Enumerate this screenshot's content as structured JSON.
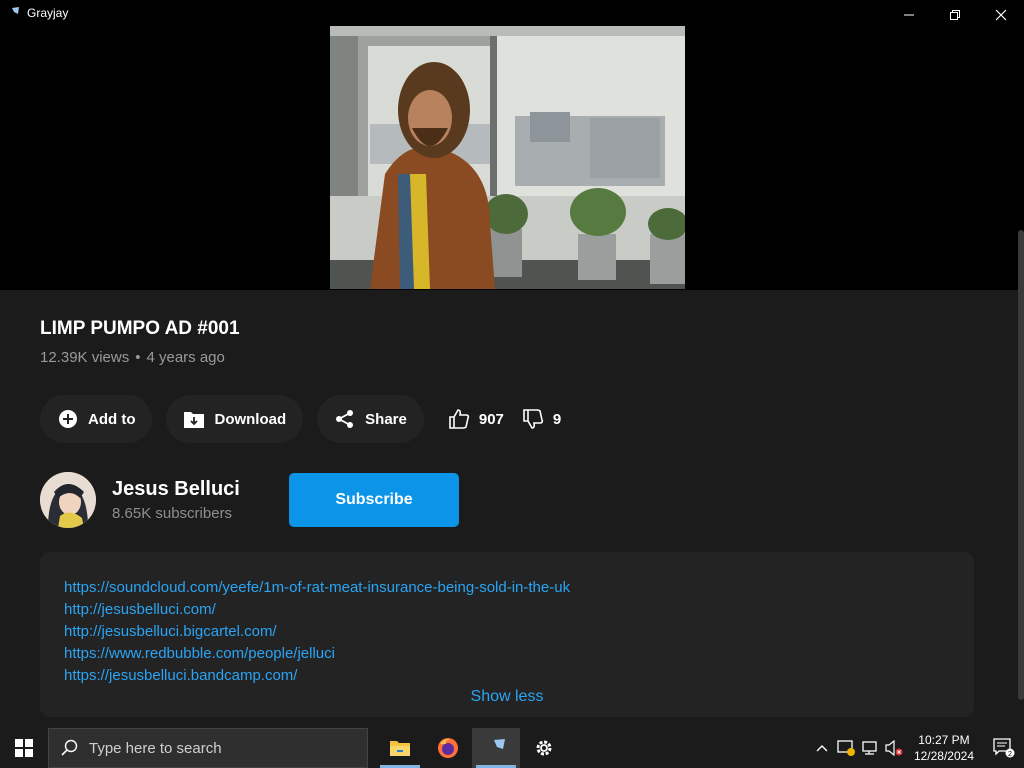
{
  "window": {
    "title": "Grayjay"
  },
  "video": {
    "title": "LIMP PUMPO AD #001",
    "views": "12.39K views",
    "separator": "•",
    "age": "4 years ago"
  },
  "actions": {
    "add_to": "Add to",
    "download": "Download",
    "share": "Share",
    "likes": "907",
    "dislikes": "9"
  },
  "channel": {
    "name": "Jesus Belluci",
    "subscribers": "8.65K subscribers",
    "subscribe_label": "Subscribe"
  },
  "description": {
    "links": [
      "https://soundcloud.com/yeefe/1m-of-rat-meat-insurance-being-sold-in-the-uk",
      "http://jesusbelluci.com/",
      "http://jesusbelluci.bigcartel.com/",
      "https://www.redbubble.com/people/jelluci",
      "https://jesusbelluci.bandcamp.com/"
    ],
    "toggle_label": "Show less"
  },
  "taskbar": {
    "search_placeholder": "Type here to search",
    "time": "10:27 PM",
    "date": "12/28/2024",
    "notification_count": "2"
  },
  "colors": {
    "accent": "#0c95e8",
    "link": "#2aa4f4",
    "background": "#1b1b1b",
    "pill": "#232323"
  }
}
